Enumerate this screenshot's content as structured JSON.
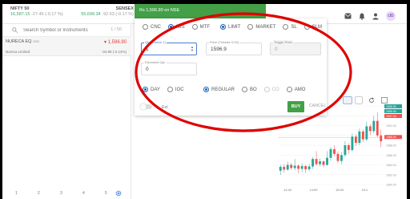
{
  "indices": [
    {
      "name": "NIFTY 50",
      "ltp": "16,587.15",
      "change": "-27.45 (-0.17 %)"
    },
    {
      "name": "SENSEX",
      "ltp": "55,699.34",
      "change": "-92.63 (-0.17 %)"
    }
  ],
  "toast": {
    "text": "Rs 1,596.90 on NSE"
  },
  "header_icons": [
    "cart-icon",
    "bell-icon",
    "user-icon"
  ],
  "avatar": {
    "initials": "UD"
  },
  "watchlist": {
    "search_placeholder": "Search Symbol or Instruments",
    "count": "1 / 50",
    "items": [
      {
        "symbol": "NURECA EQ",
        "exchange": "NSE",
        "price": "1,596.90",
        "name": "Nureca Limited",
        "change": "-34.95 (-2.14%)"
      }
    ],
    "pages": [
      "1",
      "2",
      "3",
      "4",
      "5"
    ]
  },
  "order_window": {
    "product_options": [
      {
        "label": "CNC",
        "selected": false
      },
      {
        "label": "MIS",
        "selected": true
      },
      {
        "label": "MTF",
        "selected": false
      }
    ],
    "order_type_options": [
      {
        "label": "LIMIT",
        "selected": true
      },
      {
        "label": "MARKET",
        "selected": false
      },
      {
        "label": "SL",
        "selected": false
      },
      {
        "label": "SLM",
        "selected": false
      }
    ],
    "qty": {
      "label": "Qty (Lotsize 1)",
      "value": "1"
    },
    "price": {
      "label": "Price (Ticksize 0.05)",
      "value": "1596.9"
    },
    "trigger_price": {
      "label": "Trigger Price",
      "value": "0"
    },
    "disclosed_qty": {
      "label": "Disclosed Qty",
      "value": "0"
    },
    "validity_options": [
      {
        "label": "DAY",
        "selected": true
      },
      {
        "label": "IOC",
        "selected": false
      }
    ],
    "variety_options": [
      {
        "label": "REGULAR",
        "selected": true
      },
      {
        "label": "BO",
        "selected": false
      },
      {
        "label": "CO",
        "selected": false
      },
      {
        "label": "AMO",
        "selected": false
      }
    ],
    "toggle_label": "Ext",
    "buy_label": "BUY",
    "cancel_label": "CANCEL"
  },
  "chart": {
    "type": "candlestick",
    "price_tags": [
      "1596.90",
      "1596.90",
      "1597.00",
      "1588.90"
    ],
    "y_ticks": [
      "1596.00",
      "1594.00",
      "1592.00",
      "1590.00",
      "1588.00",
      "1586.00",
      "1584.00",
      "1582.00",
      "1580.00"
    ],
    "x_ticks": [
      "14:40",
      "14:50",
      "15:00",
      "15:1"
    ],
    "candles": [
      {
        "o": 1581.5,
        "c": 1582.5,
        "h": 1583.0,
        "l": 1580.5
      },
      {
        "o": 1582.5,
        "c": 1581.8,
        "h": 1583.2,
        "l": 1581.0
      },
      {
        "o": 1581.8,
        "c": 1583.0,
        "h": 1583.8,
        "l": 1581.5
      },
      {
        "o": 1583.0,
        "c": 1582.2,
        "h": 1583.5,
        "l": 1581.8
      },
      {
        "o": 1582.2,
        "c": 1582.8,
        "h": 1584.5,
        "l": 1581.6
      },
      {
        "o": 1582.8,
        "c": 1582.0,
        "h": 1583.1,
        "l": 1580.9
      },
      {
        "o": 1582.0,
        "c": 1582.7,
        "h": 1583.4,
        "l": 1581.2
      },
      {
        "o": 1582.7,
        "c": 1581.9,
        "h": 1583.0,
        "l": 1581.0
      },
      {
        "o": 1581.9,
        "c": 1582.6,
        "h": 1583.3,
        "l": 1581.4
      },
      {
        "o": 1582.6,
        "c": 1584.5,
        "h": 1585.0,
        "l": 1582.0
      },
      {
        "o": 1584.5,
        "c": 1583.2,
        "h": 1586.5,
        "l": 1582.8
      },
      {
        "o": 1583.2,
        "c": 1583.9,
        "h": 1584.6,
        "l": 1582.6
      },
      {
        "o": 1583.9,
        "c": 1583.0,
        "h": 1584.2,
        "l": 1582.4
      },
      {
        "o": 1583.0,
        "c": 1584.8,
        "h": 1586.5,
        "l": 1582.8
      },
      {
        "o": 1584.8,
        "c": 1587.0,
        "h": 1587.6,
        "l": 1584.0
      },
      {
        "o": 1587.0,
        "c": 1585.8,
        "h": 1588.0,
        "l": 1585.2
      },
      {
        "o": 1585.8,
        "c": 1584.0,
        "h": 1586.4,
        "l": 1583.5
      },
      {
        "o": 1584.0,
        "c": 1585.5,
        "h": 1586.2,
        "l": 1583.2
      },
      {
        "o": 1585.5,
        "c": 1588.0,
        "h": 1589.0,
        "l": 1585.0
      },
      {
        "o": 1588.0,
        "c": 1586.8,
        "h": 1588.5,
        "l": 1585.8
      },
      {
        "o": 1586.8,
        "c": 1590.2,
        "h": 1591.0,
        "l": 1586.4
      },
      {
        "o": 1590.2,
        "c": 1588.6,
        "h": 1590.8,
        "l": 1587.8
      },
      {
        "o": 1588.6,
        "c": 1591.5,
        "h": 1592.2,
        "l": 1588.0
      },
      {
        "o": 1591.5,
        "c": 1589.5,
        "h": 1592.0,
        "l": 1588.8
      },
      {
        "o": 1589.5,
        "c": 1592.8,
        "h": 1594.0,
        "l": 1589.0
      },
      {
        "o": 1592.8,
        "c": 1591.6,
        "h": 1593.4,
        "l": 1590.6
      },
      {
        "o": 1591.6,
        "c": 1594.2,
        "h": 1595.5,
        "l": 1591.0
      },
      {
        "o": 1594.2,
        "c": 1590.5,
        "h": 1596.3,
        "l": 1590.0
      },
      {
        "o": 1590.5,
        "c": 1589.0,
        "h": 1592.0,
        "l": 1587.5
      }
    ],
    "y_range": [
      1578,
      1598
    ],
    "colors": {
      "up": "#26a69a",
      "down": "#ef5350"
    }
  },
  "colors": {
    "accent_green": "#43a047",
    "accent_blue": "#1e63b8",
    "annotation_red": "#e00000",
    "loss_red": "#e53935"
  }
}
